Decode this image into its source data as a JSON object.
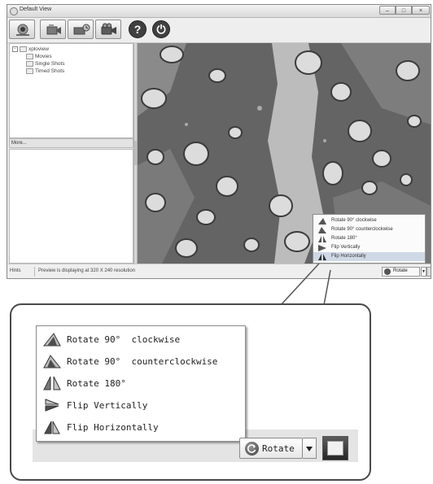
{
  "window": {
    "title": "Default View",
    "controls": {
      "minimize": "–",
      "maximize": "□",
      "close": "×"
    }
  },
  "toolbar": {
    "buttons": [
      {
        "icon": "webcam-icon"
      },
      {
        "icon": "snapshot-icon"
      },
      {
        "icon": "timed-shot-icon"
      },
      {
        "icon": "video-camera-icon"
      },
      {
        "icon": "help-icon",
        "glyph": "?"
      },
      {
        "icon": "power-icon",
        "glyph": "⏻"
      }
    ]
  },
  "tree": {
    "root": "xploview",
    "items": [
      "Movies",
      "Single Shots",
      "Timed Shots"
    ]
  },
  "more_label": "More...",
  "mini_menu": {
    "items": [
      {
        "label": "Rotate 90° clockwise",
        "icon": "rotate-cw-icon"
      },
      {
        "label": "Rotate 90° counterclockwise",
        "icon": "rotate-ccw-icon"
      },
      {
        "label": "Rotate 180°",
        "icon": "rotate-180-icon"
      },
      {
        "label": "Flip Vertically",
        "icon": "flip-vertical-icon"
      },
      {
        "label": "Flip Horizontally",
        "icon": "flip-horizontal-icon",
        "selected": true
      }
    ]
  },
  "statusbar": {
    "hints_label": "Hints",
    "message": "Preview is displaying at 320 X 240 resolution",
    "rotate_label": "Rotate"
  },
  "zoom_menu": {
    "items": [
      {
        "label": "Rotate 90°  clockwise",
        "icon": "rotate-cw-icon"
      },
      {
        "label": "Rotate 90°  counterclockwise",
        "icon": "rotate-ccw-icon"
      },
      {
        "label": "Rotate 180°",
        "icon": "rotate-180-icon"
      },
      {
        "label": "Flip Vertically",
        "icon": "flip-vertical-icon"
      },
      {
        "label": "Flip Horizontally",
        "icon": "flip-horizontal-icon"
      }
    ],
    "rotate_button": "Rotate"
  },
  "colors": {
    "menu_selection": "#cfd9e6",
    "preview_tissue": "#636363",
    "preview_cells": "#d9d9d9"
  }
}
